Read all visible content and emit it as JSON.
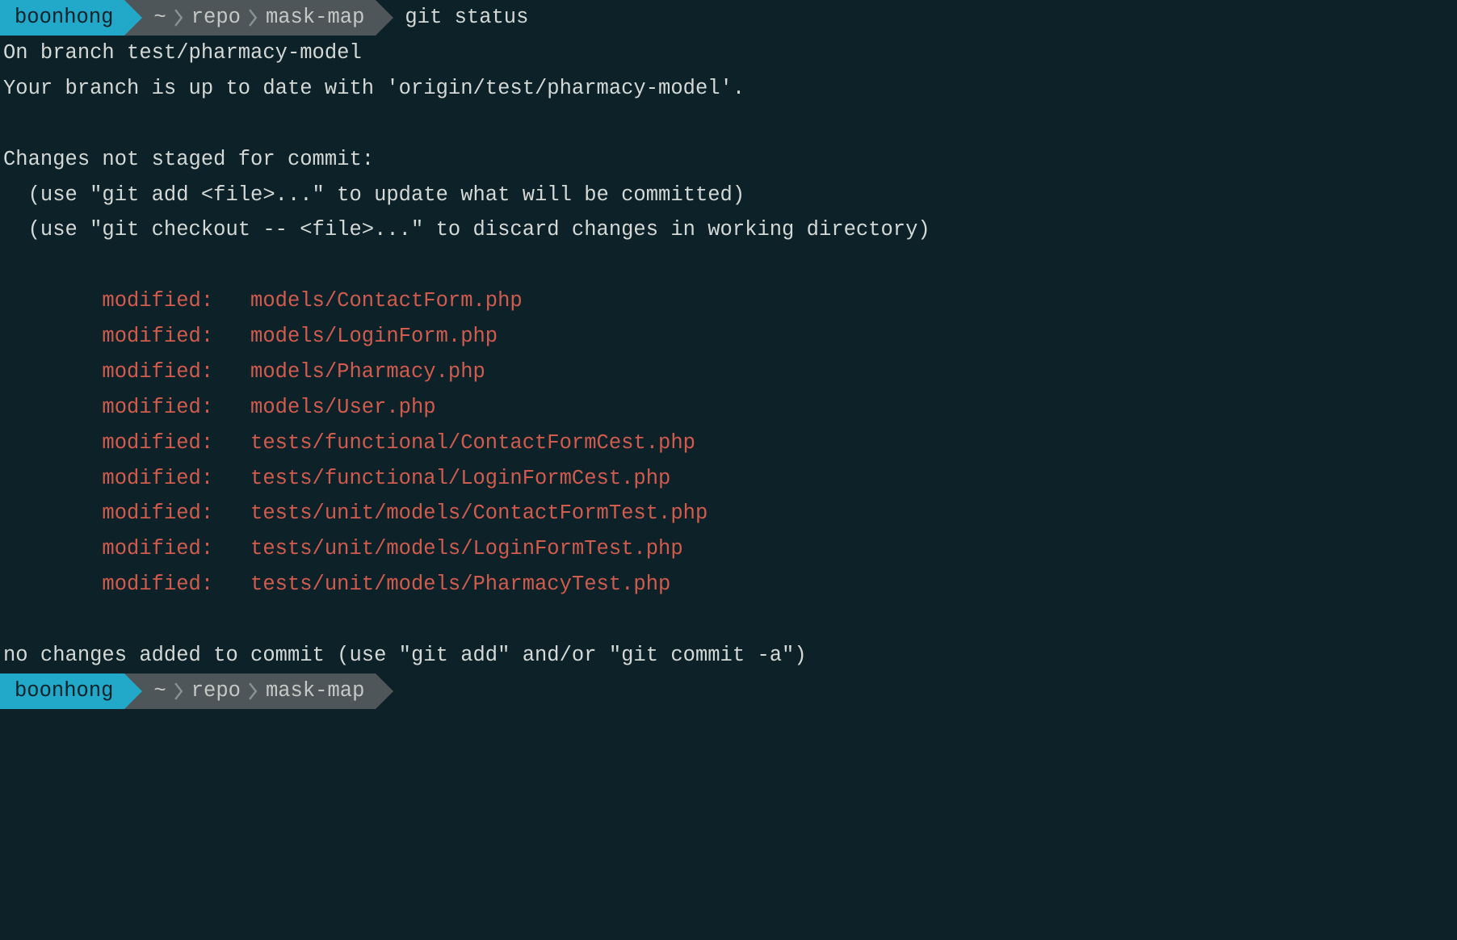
{
  "prompt1": {
    "user": "boonhong",
    "path": [
      "~",
      "repo",
      "mask-map"
    ],
    "command": "git status"
  },
  "output": {
    "branch_line": "On branch test/pharmacy-model",
    "tracking_line": "Your branch is up to date with 'origin/test/pharmacy-model'.",
    "unstaged_header": "Changes not staged for commit:",
    "hint_add": "  (use \"git add <file>...\" to update what will be committed)",
    "hint_checkout": "  (use \"git checkout -- <file>...\" to discard changes in working directory)",
    "modified_files": [
      "models/ContactForm.php",
      "models/LoginForm.php",
      "models/Pharmacy.php",
      "models/User.php",
      "tests/functional/ContactFormCest.php",
      "tests/functional/LoginFormCest.php",
      "tests/unit/models/ContactFormTest.php",
      "tests/unit/models/LoginFormTest.php",
      "tests/unit/models/PharmacyTest.php"
    ],
    "modified_label": "modified:",
    "no_changes_line": "no changes added to commit (use \"git add\" and/or \"git commit -a\")"
  },
  "prompt2": {
    "user": "boonhong",
    "path": [
      "~",
      "repo",
      "mask-map"
    ],
    "command": ""
  }
}
